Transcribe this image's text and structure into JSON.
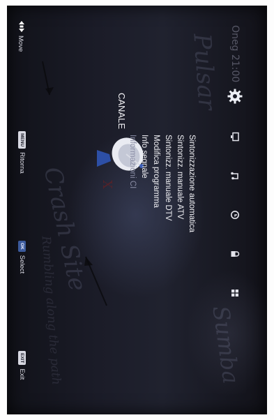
{
  "tv": {
    "clock": "Oneg 21:00",
    "section_title": "CANALE",
    "background_text": [
      "Pulsar",
      "Sumba",
      "Crash Site",
      "Rumbling along the path"
    ],
    "tabs": [
      {
        "name": "canale",
        "icon": "gear-icon",
        "selected": true
      },
      {
        "name": "immagine",
        "icon": "picture-icon"
      },
      {
        "name": "audio",
        "icon": "music-note-icon"
      },
      {
        "name": "ora",
        "icon": "clock-icon"
      },
      {
        "name": "blocco",
        "icon": "lock-icon"
      },
      {
        "name": "impostazioni",
        "icon": "grid-icon"
      }
    ],
    "menu_items": [
      {
        "label": "Sintonizzazione automatica",
        "enabled": true
      },
      {
        "label": "Sintonizz. manuale ATV",
        "enabled": true
      },
      {
        "label": "Sintonizz. manuale DTV",
        "enabled": true
      },
      {
        "label": "Modifica programma",
        "enabled": true
      },
      {
        "label": "Info segnale",
        "enabled": true
      },
      {
        "label": "Informazioni CI",
        "enabled": false
      }
    ],
    "hints": [
      {
        "key": "",
        "icon": "arrows-icon",
        "label": "Move"
      },
      {
        "key": "MENU",
        "label": "Ritorna"
      },
      {
        "key": "OK",
        "label": "Select"
      },
      {
        "key": "EXIT",
        "label": "Exit"
      }
    ],
    "colors": {
      "background": "#1b1c28",
      "text": "#f1f1f5",
      "dim_text": "#8b8ea6",
      "ok_key": "#3b5a9c"
    }
  }
}
